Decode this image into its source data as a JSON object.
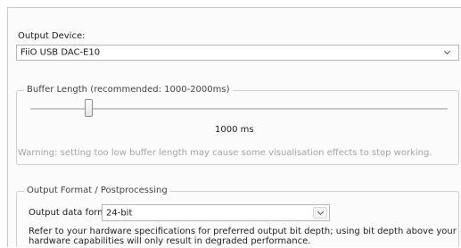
{
  "output_device": {
    "label": "Output Device:",
    "selected": "FiiO USB DAC-E10"
  },
  "buffer": {
    "group_title": "Buffer Length (recommended: 1000-2000ms)",
    "slider_fraction": 0.14,
    "value_text": "1000 ms",
    "warning": "Warning: setting too low buffer length may cause some visualisation effects to stop working."
  },
  "output_format": {
    "group_title": "Output Format / Postprocessing",
    "data_format_label": "Output data format:",
    "data_format_selected": "24-bit",
    "info": "Refer to your hardware specifications for preferred output bit depth; using bit depth above your hardware capabilities will only result in degraded performance."
  },
  "icons": {
    "dropdown": "chevron-down-icon"
  }
}
